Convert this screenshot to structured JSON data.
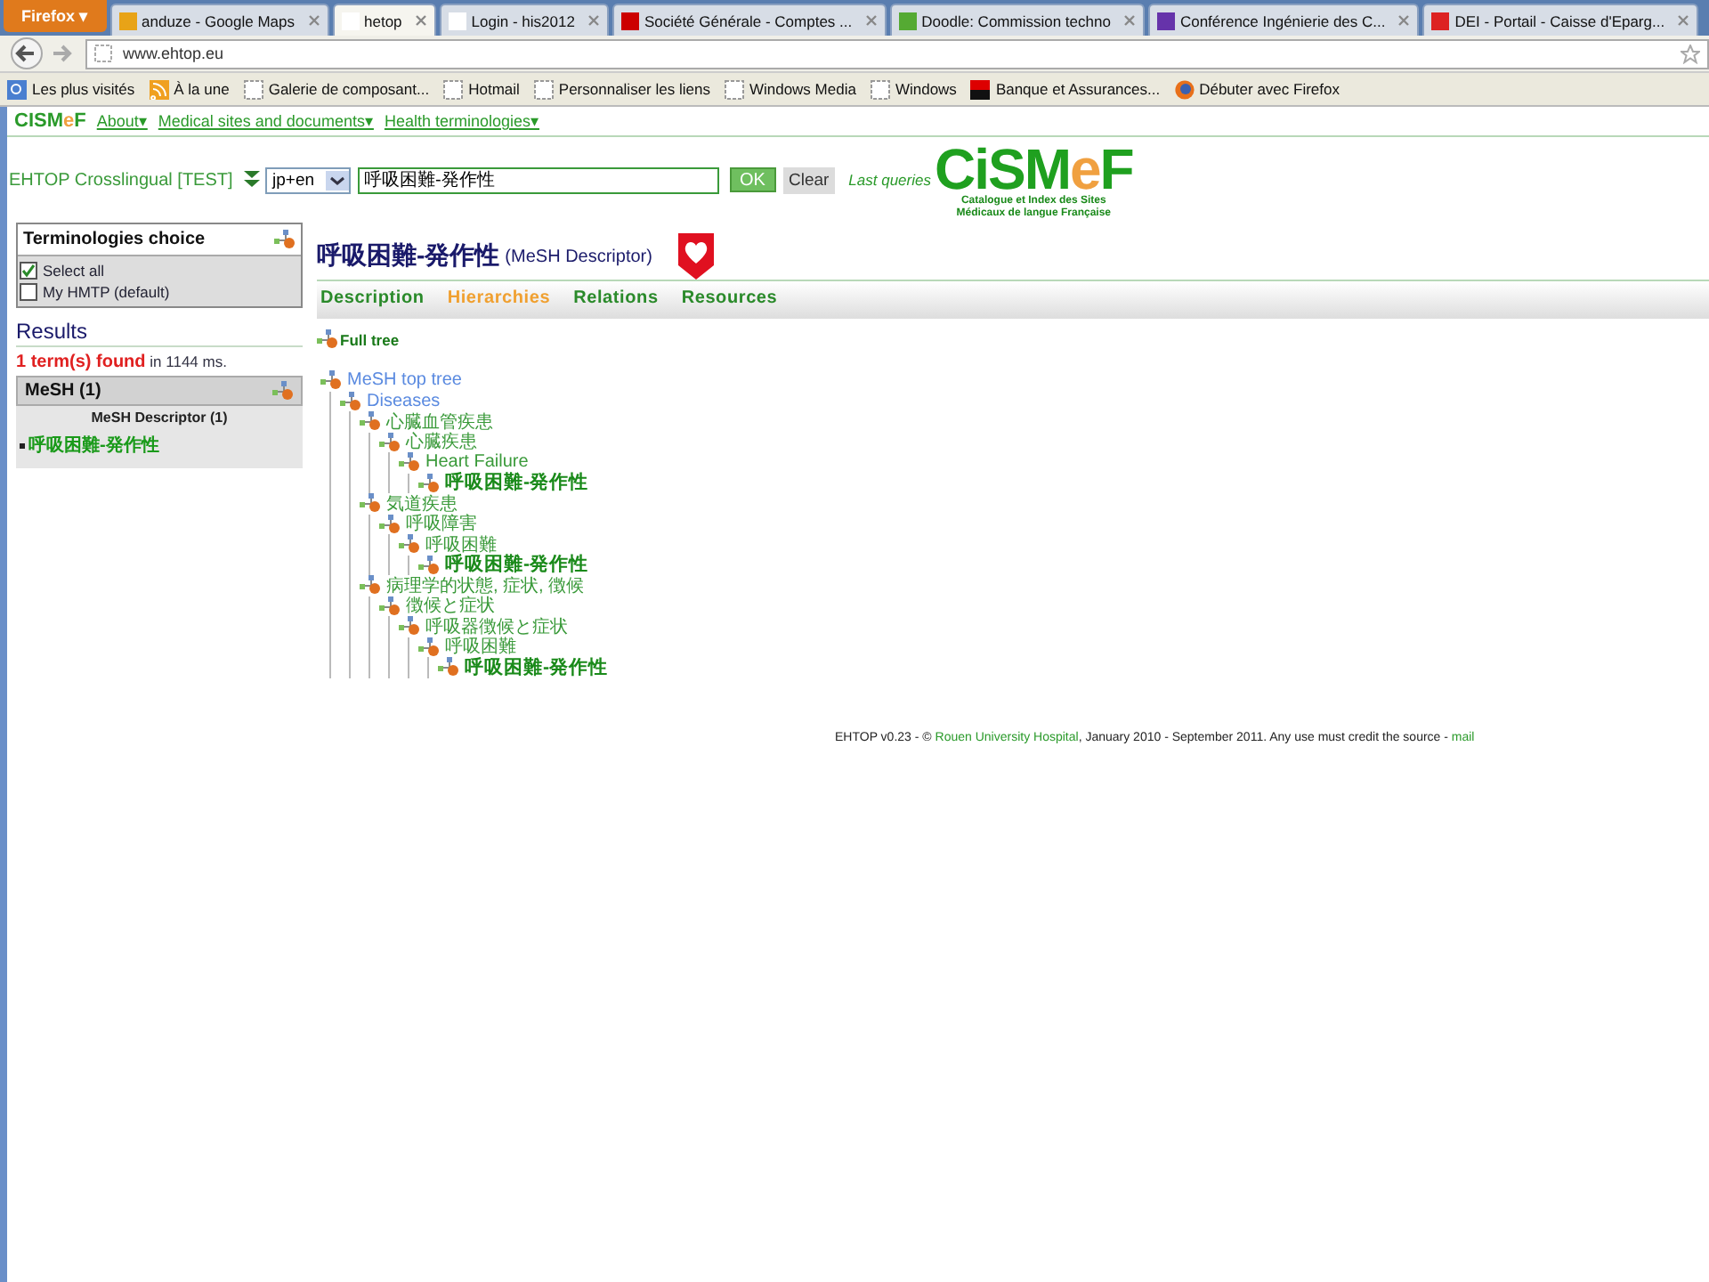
{
  "browser": {
    "menu_button": "Firefox ▾",
    "tabs": [
      {
        "title": "anduze - Google Maps",
        "selected": false,
        "color": "#e8a317"
      },
      {
        "title": "hetop",
        "selected": true,
        "color": "#ffffff"
      },
      {
        "title": "Login - his2012",
        "selected": false,
        "color": "#ffffff"
      },
      {
        "title": "Société Générale - Comptes ...",
        "selected": false,
        "color": "#cc0000"
      },
      {
        "title": "Doodle: Commission techno",
        "selected": false,
        "color": "#55aa33"
      },
      {
        "title": "Conférence Ingénierie des C...",
        "selected": false,
        "color": "#6633aa"
      },
      {
        "title": "DEI - Portail - Caisse d'Eparg...",
        "selected": false,
        "color": "#dd2222"
      }
    ],
    "address": "www.ehtop.eu",
    "bookmarks": [
      {
        "label": "Les plus visités",
        "kind": "special"
      },
      {
        "label": "À la une",
        "kind": "feed"
      },
      {
        "label": "Galerie de composant...",
        "kind": "page"
      },
      {
        "label": "Hotmail",
        "kind": "page"
      },
      {
        "label": "Personnaliser les liens",
        "kind": "page"
      },
      {
        "label": "Windows Media",
        "kind": "page"
      },
      {
        "label": "Windows",
        "kind": "page"
      },
      {
        "label": "Banque et Assurances...",
        "kind": "bank"
      },
      {
        "label": "Débuter avec Firefox",
        "kind": "firefox"
      }
    ]
  },
  "site_menu": {
    "brand": {
      "before": "CISM",
      "accent": "e",
      "after": "F"
    },
    "items": [
      "About▾",
      "Medical sites and documents▾",
      "Health terminologies▾"
    ]
  },
  "header": {
    "app_title": "EHTOP Crosslingual [TEST]",
    "language": "jp+en",
    "query": "呼吸困難-発作性",
    "ok_button": "OK",
    "clear_button": "Clear",
    "last_queries": "Last queries",
    "logo": {
      "before": "CiSM",
      "accent": "e",
      "after": "F",
      "subtitle": [
        "Catalogue et Index des Sites",
        "Médicaux de langue Française"
      ]
    }
  },
  "terminologies": {
    "title": "Terminologies choice",
    "options": [
      {
        "label": "Select all",
        "checked": true
      },
      {
        "label": "My HMTP (default)",
        "checked": false
      }
    ]
  },
  "results": {
    "title": "Results",
    "summary": "**1 term(s) found** in 1144 ms.",
    "group": "MeSH (1)",
    "subgroup": "MeSH Descriptor (1)",
    "items": [
      "呼吸困難-発作性"
    ]
  },
  "term": {
    "name": "呼吸困難-発作性",
    "type": "(MeSH Descriptor)"
  },
  "tabs": [
    {
      "label": "Description",
      "selected": false
    },
    {
      "label": "Hierarchies",
      "selected": true
    },
    {
      "label": "Relations",
      "selected": false
    },
    {
      "label": "Resources",
      "selected": false
    }
  ],
  "full_tree": "Full tree",
  "tree": [
    {
      "label": "MeSH top tree",
      "kind": "link",
      "children": [
        {
          "label": "Diseases",
          "kind": "link",
          "children": [
            {
              "label": "心臓血管疾患",
              "kind": "term",
              "children": [
                {
                  "label": "心臓疾患",
                  "kind": "term",
                  "children": [
                    {
                      "label": "Heart Failure",
                      "kind": "term",
                      "children": [
                        {
                          "label": "呼吸困難-発作性",
                          "kind": "current"
                        }
                      ]
                    }
                  ]
                }
              ]
            },
            {
              "label": "気道疾患",
              "kind": "term",
              "children": [
                {
                  "label": "呼吸障害",
                  "kind": "term",
                  "children": [
                    {
                      "label": "呼吸困難",
                      "kind": "term",
                      "children": [
                        {
                          "label": "呼吸困難-発作性",
                          "kind": "current"
                        }
                      ]
                    }
                  ]
                }
              ]
            },
            {
              "label": "病理学的状態, 症状, 徴候",
              "kind": "term",
              "children": [
                {
                  "label": "徴候と症状",
                  "kind": "term",
                  "children": [
                    {
                      "label": "呼吸器徴候と症状",
                      "kind": "term",
                      "children": [
                        {
                          "label": "呼吸困難",
                          "kind": "term",
                          "children": [
                            {
                              "label": "呼吸困難-発作性",
                              "kind": "current"
                            }
                          ]
                        }
                      ]
                    }
                  ]
                }
              ]
            }
          ]
        }
      ]
    }
  ],
  "footer": {
    "before": "EHTOP v0.23 - © ",
    "link": "Rouen University Hospital",
    "middle": ", January 2010 - September 2011. Any use must credit the source - ",
    "mail": "mail"
  }
}
